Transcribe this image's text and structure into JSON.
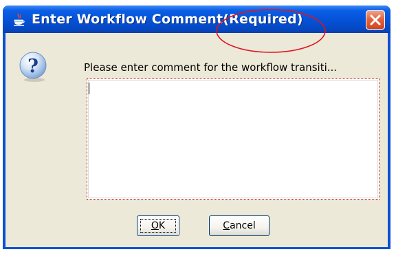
{
  "window": {
    "title": "Enter Workflow Comment(Required)"
  },
  "dialog": {
    "prompt": "Please enter comment for the workflow transiti...",
    "comment_value": ""
  },
  "buttons": {
    "ok": {
      "mnemonic": "O",
      "rest": "K"
    },
    "cancel": {
      "mnemonic": "C",
      "rest": "ancel"
    }
  },
  "icons": {
    "title_icon": "java-cup-icon",
    "close_icon": "close-icon",
    "question_icon": "question-icon"
  },
  "colors": {
    "titlebar": "#0553d8",
    "dialog_bg": "#ece9d8",
    "close_button": "#d1451f",
    "annotation_circle": "#e0141e"
  }
}
